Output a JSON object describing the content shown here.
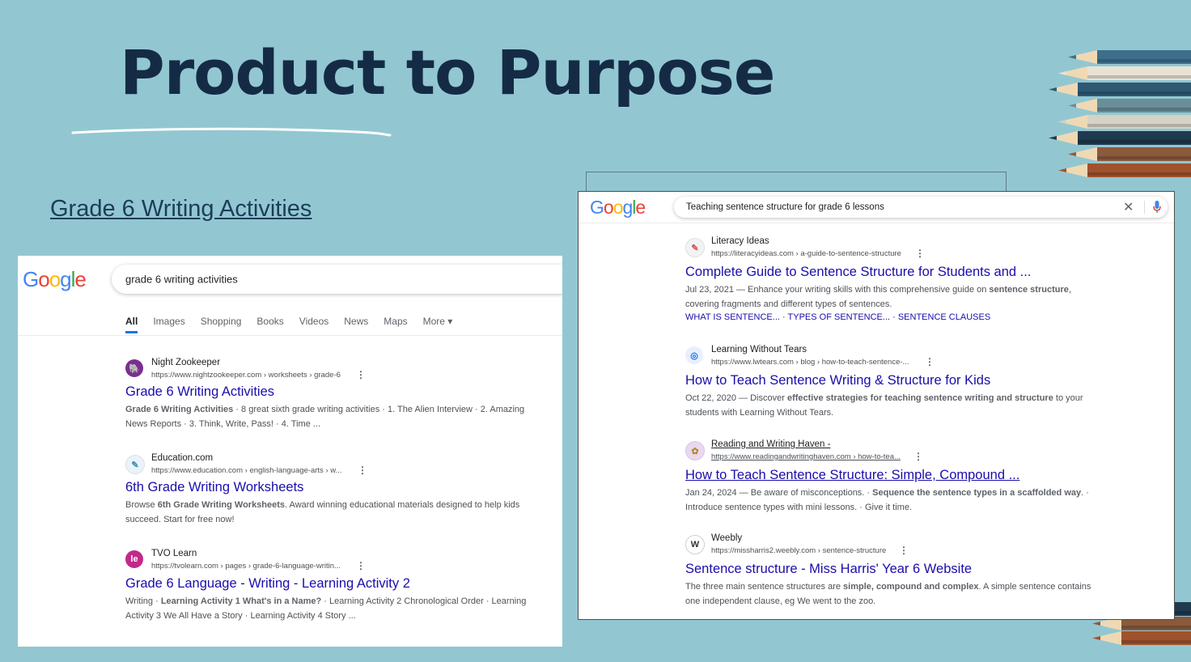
{
  "slide": {
    "title": "Product to Purpose",
    "link_text": "Grade 6 Writing Activities"
  },
  "colors": {
    "background": "#92c7d2",
    "title": "#152b45",
    "result_title": "#1a0dab"
  },
  "logo_text": "Google",
  "left_search": {
    "query": "grade 6 writing activities",
    "tabs": [
      "All",
      "Images",
      "Shopping",
      "Books",
      "Videos",
      "News",
      "Maps",
      "More"
    ],
    "results": [
      {
        "site": "Night Zookeeper",
        "url": "https://www.nightzookeeper.com › worksheets › grade-6",
        "title": "Grade 6 Writing Activities",
        "snippet_bold": "Grade 6 Writing Activities",
        "snippet": " · 8 great sixth grade writing activities · 1. The Alien Interview · 2. Amazing News Reports · 3. Think, Write, Pass! · 4. Time ...",
        "icon": "elephant-icon"
      },
      {
        "site": "Education.com",
        "url": "https://www.education.com › english-language-arts › w...",
        "title": "6th Grade Writing Worksheets",
        "snippet_pre": "Browse ",
        "snippet_bold": "6th Grade Writing Worksheets",
        "snippet": ". Award winning educational materials designed to help kids succeed. Start for free now!",
        "icon": "education-icon"
      },
      {
        "site": "TVO Learn",
        "url": "https://tvolearn.com › pages › grade-6-language-writin...",
        "title": "Grade 6 Language - Writing - Learning Activity 2",
        "snippet_pre": "Writing · ",
        "snippet_bold": "Learning Activity 1 What's in a Name?",
        "snippet": " · Learning Activity 2 Chronological Order · Learning Activity 3 We All Have a Story · Learning Activity 4 Story ...",
        "icon": "tvo-icon",
        "icon_text": "le"
      }
    ]
  },
  "right_search": {
    "query": "Teaching sentence structure for grade 6 lessons",
    "results": [
      {
        "site": "Literacy Ideas",
        "url": "https://literacyideas.com › a-guide-to-sentence-structure",
        "title": "Complete Guide to Sentence Structure for Students and ...",
        "date": "Jul 23, 2021",
        "snippet_a": " — Enhance your writing skills with this comprehensive guide on ",
        "snippet_bold": "sentence structure",
        "snippet_b": ", covering fragments and different types of sentences.",
        "sitelinks": [
          "WHAT IS SENTENCE...",
          "TYPES OF SENTENCE...",
          "SENTENCE CLAUSES"
        ]
      },
      {
        "site": "Learning Without Tears",
        "url": "https://www.lwtears.com › blog › how-to-teach-sentence-...",
        "title": "How to Teach Sentence Writing & Structure for Kids",
        "date": "Oct 22, 2020",
        "snippet_a": " — Discover ",
        "snippet_bold": "effective strategies for teaching sentence writing and structure",
        "snippet_b": " to your students with Learning Without Tears."
      },
      {
        "site": "Reading and Writing Haven -",
        "url": "https://www.readingandwritinghaven.com › how-to-tea...",
        "title": "How to Teach Sentence Structure: Simple, Compound ...",
        "date": "Jan 24, 2024",
        "snippet_a": " — Be aware of misconceptions. · ",
        "snippet_bold": "Sequence the sentence types in a scaffolded way",
        "snippet_b": ". · Introduce sentence types with mini lessons. · Give it time."
      },
      {
        "site": "Weebly",
        "url": "https://missharris2.weebly.com › sentence-structure",
        "title": "Sentence structure - Miss Harris' Year 6 Website",
        "snippet_a": "The three main sentence structures are ",
        "snippet_bold": "simple, compound and complex",
        "snippet_b": ". A simple sentence contains one independent clause, eg We went to the zoo."
      }
    ]
  }
}
